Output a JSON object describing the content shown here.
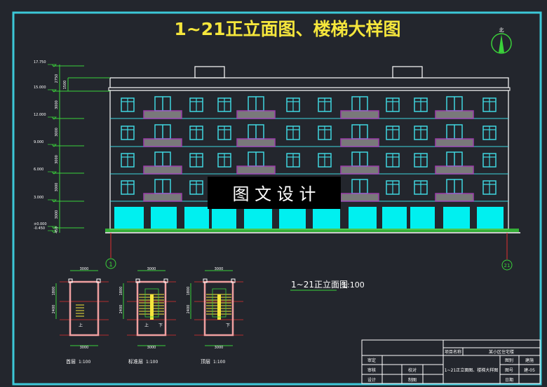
{
  "title": "1~21正立面图、楼梯大样图",
  "north_label": "北",
  "watermark": "图 文 设 计",
  "elevation_caption": {
    "name": "1~21正立面图",
    "scale": "1:100"
  },
  "axis_labels": {
    "left": "1",
    "right": "21"
  },
  "levels": [
    "17.750",
    "15.000",
    "12.000",
    "9.000",
    "6.000",
    "3.000",
    "±0.000",
    "-0.450"
  ],
  "dimensions": [
    "2750",
    "3000",
    "3000",
    "3000",
    "3000",
    "3000",
    "450"
  ],
  "parapet_dim": "1500",
  "stairs": [
    {
      "name": "首层",
      "scale": "1:100",
      "top_dim": "3000",
      "bottom_dim": "3000",
      "dims": [
        "1800",
        "2400"
      ],
      "marks": [
        "上"
      ]
    },
    {
      "name": "标准层",
      "scale": "1:100",
      "top_dim": "3000",
      "bottom_dim": "3000",
      "dims": [
        "1800",
        "2400"
      ],
      "marks": [
        "上",
        "下"
      ]
    },
    {
      "name": "顶层",
      "scale": "1:100",
      "top_dim": "3000",
      "bottom_dim": "3000",
      "dims": [
        "1800",
        "2400"
      ],
      "marks": [
        "下"
      ]
    }
  ],
  "title_block": {
    "project_label": "项目名称",
    "project_value": "某小区住宅楼",
    "drawing_name": "1~21正立面图、楼梯大样图",
    "rows": [
      {
        "a": "审定",
        "b": "",
        "c": ""
      },
      {
        "a": "审核",
        "b": "校对",
        "c": ""
      },
      {
        "a": "设计",
        "b": "制图",
        "c": ""
      }
    ],
    "right": [
      {
        "label": "图别",
        "value": "建施"
      },
      {
        "label": "图号",
        "value": "建-05"
      },
      {
        "label": "日期",
        "value": ""
      }
    ]
  },
  "colors": {
    "frame": "#3cc8d8",
    "title": "#f5e63c",
    "window": "#3fd6e0",
    "balcony": "#b040c0",
    "shop": "#00f0f0",
    "dim": "#3ad13a",
    "grid": "#e03030"
  }
}
